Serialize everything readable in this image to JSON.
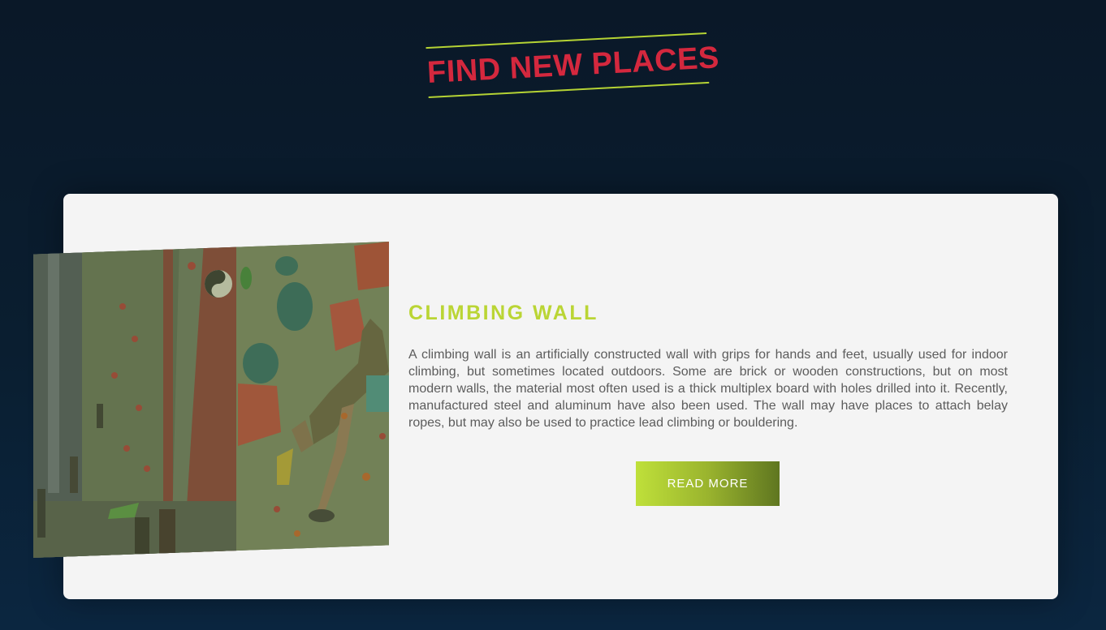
{
  "section": {
    "title": "FIND NEW PLACES"
  },
  "card": {
    "heading": "CLIMBING WALL",
    "description": "A climbing wall is an artificially constructed wall with grips for hands and feet, usually used for indoor climbing, but sometimes located outdoors. Some are brick or wooden constructions, but on most modern walls, the material most often used is a thick multiplex board with holes drilled into it. Recently, manufactured steel and aluminum have also been used. The wall may have places to attach belay ropes, but may also be used to practice lead climbing or bouldering.",
    "button_label": "READ MORE",
    "image_subject": "climbing-wall-photo"
  },
  "colors": {
    "background": "#0a1e30",
    "title_red": "#d4283e",
    "accent_green": "#bad534",
    "card_bg": "#f4f4f4",
    "body_text": "#5c5c5c"
  }
}
